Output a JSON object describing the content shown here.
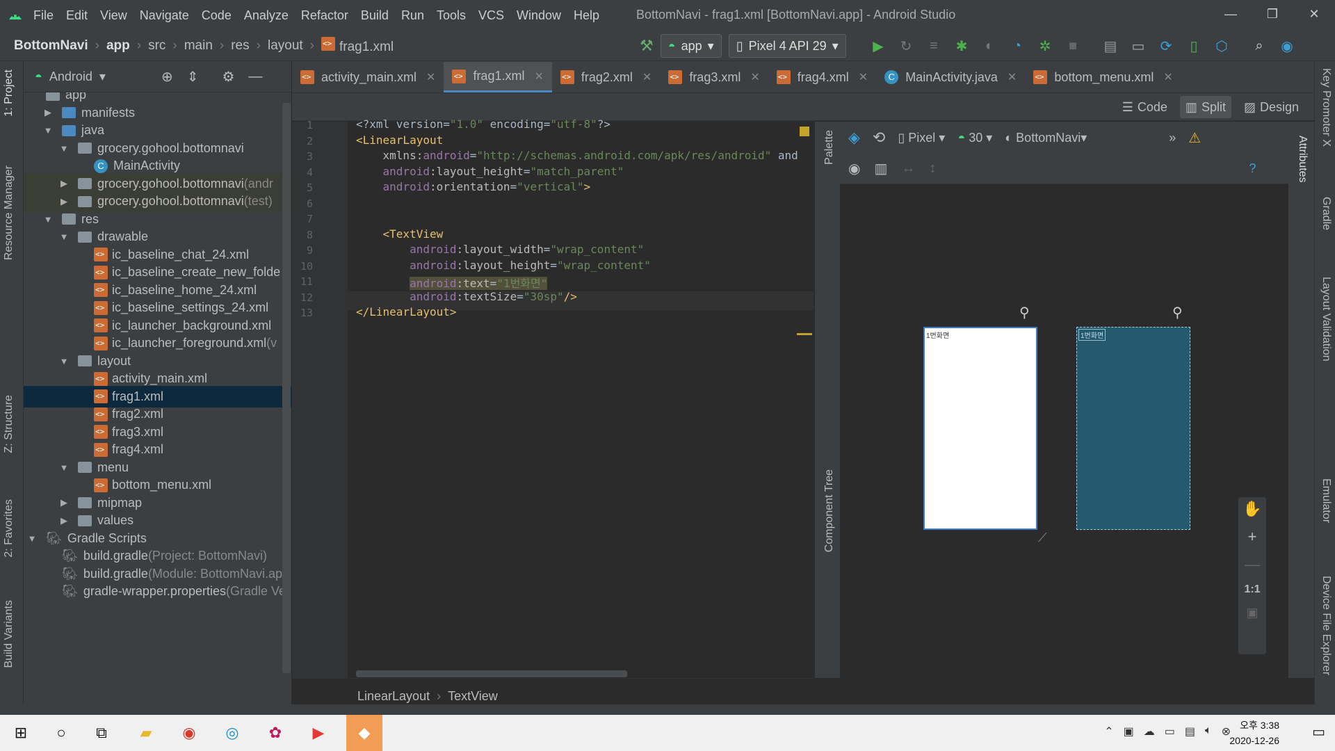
{
  "titlebar": {
    "menu": [
      "File",
      "Edit",
      "View",
      "Navigate",
      "Code",
      "Analyze",
      "Refactor",
      "Build",
      "Run",
      "Tools",
      "VCS",
      "Window",
      "Help"
    ],
    "window_title": "BottomNavi - frag1.xml [BottomNavi.app] - Android Studio"
  },
  "navbar": {
    "crumbs": [
      "BottomNavi",
      "app",
      "src",
      "main",
      "res",
      "layout",
      "frag1.xml"
    ],
    "run_config": "app",
    "device": "Pixel 4 API 29"
  },
  "left_strip": [
    "1: Project",
    "Resource Manager",
    "Z: Structure",
    "2: Favorites",
    "Build Variants"
  ],
  "right_strip": [
    "Key Promoter X",
    "Gradle",
    "Layout Validation",
    "Emulator",
    "Device File Explorer"
  ],
  "project": {
    "view": "Android",
    "tree": [
      {
        "label": "app",
        "indent": 0,
        "arrow": "",
        "icon": "folder"
      },
      {
        "label": "manifests",
        "indent": 1,
        "arrow": "▶",
        "icon": "folder-blue"
      },
      {
        "label": "java",
        "indent": 1,
        "arrow": "▼",
        "icon": "folder-blue"
      },
      {
        "label": "grocery.gohool.bottomnavi",
        "indent": 2,
        "arrow": "▼",
        "icon": "folder"
      },
      {
        "label": "MainActivity",
        "indent": 3,
        "arrow": "",
        "icon": "class"
      },
      {
        "label": "grocery.gohool.bottomnavi",
        "suffix": " (andr",
        "indent": 2,
        "arrow": "▶",
        "icon": "folder",
        "state": "hl"
      },
      {
        "label": "grocery.gohool.bottomnavi",
        "suffix": " (test)",
        "indent": 2,
        "arrow": "▶",
        "icon": "folder",
        "state": "hl"
      },
      {
        "label": "res",
        "indent": 1,
        "arrow": "▼",
        "icon": "folder"
      },
      {
        "label": "drawable",
        "indent": 2,
        "arrow": "▼",
        "icon": "folder"
      },
      {
        "label": "ic_baseline_chat_24.xml",
        "indent": 3,
        "arrow": "",
        "icon": "xml"
      },
      {
        "label": "ic_baseline_create_new_folde",
        "indent": 3,
        "arrow": "",
        "icon": "xml"
      },
      {
        "label": "ic_baseline_home_24.xml",
        "indent": 3,
        "arrow": "",
        "icon": "xml"
      },
      {
        "label": "ic_baseline_settings_24.xml",
        "indent": 3,
        "arrow": "",
        "icon": "xml"
      },
      {
        "label": "ic_launcher_background.xml",
        "indent": 3,
        "arrow": "",
        "icon": "xml"
      },
      {
        "label": "ic_launcher_foreground.xml",
        "suffix": " (v",
        "indent": 3,
        "arrow": "",
        "icon": "xml"
      },
      {
        "label": "layout",
        "indent": 2,
        "arrow": "▼",
        "icon": "folder"
      },
      {
        "label": "activity_main.xml",
        "indent": 3,
        "arrow": "",
        "icon": "xml"
      },
      {
        "label": "frag1.xml",
        "indent": 3,
        "arrow": "",
        "icon": "xml",
        "state": "sel"
      },
      {
        "label": "frag2.xml",
        "indent": 3,
        "arrow": "",
        "icon": "xml"
      },
      {
        "label": "frag3.xml",
        "indent": 3,
        "arrow": "",
        "icon": "xml"
      },
      {
        "label": "frag4.xml",
        "indent": 3,
        "arrow": "",
        "icon": "xml"
      },
      {
        "label": "menu",
        "indent": 2,
        "arrow": "▼",
        "icon": "folder"
      },
      {
        "label": "bottom_menu.xml",
        "indent": 3,
        "arrow": "",
        "icon": "xml"
      },
      {
        "label": "mipmap",
        "indent": 2,
        "arrow": "▶",
        "icon": "folder"
      },
      {
        "label": "values",
        "indent": 2,
        "arrow": "▶",
        "icon": "folder"
      },
      {
        "label": "Gradle Scripts",
        "indent": 0,
        "arrow": "▼",
        "icon": "gradle"
      },
      {
        "label": "build.gradle",
        "suffix": " (Project: BottomNavi)",
        "indent": 1,
        "arrow": "",
        "icon": "gradle"
      },
      {
        "label": "build.gradle",
        "suffix": " (Module: BottomNavi.ap",
        "indent": 1,
        "arrow": "",
        "icon": "gradle"
      },
      {
        "label": "gradle-wrapper.properties",
        "suffix": " (Gradle Ve",
        "indent": 1,
        "arrow": "",
        "icon": "props"
      }
    ]
  },
  "tabs": [
    {
      "label": "activity_main.xml",
      "icon": "xml"
    },
    {
      "label": "frag1.xml",
      "icon": "xml",
      "active": true
    },
    {
      "label": "frag2.xml",
      "icon": "xml"
    },
    {
      "label": "frag3.xml",
      "icon": "xml"
    },
    {
      "label": "frag4.xml",
      "icon": "xml"
    },
    {
      "label": "MainActivity.java",
      "icon": "class"
    },
    {
      "label": "bottom_menu.xml",
      "icon": "xml"
    }
  ],
  "modes": [
    "Code",
    "Split",
    "Design"
  ],
  "code": {
    "line_numbers": [
      "1",
      "2",
      "3",
      "4",
      "5",
      "6",
      "7",
      "8",
      "9",
      "10",
      "11",
      "12",
      "13"
    ],
    "lines": [
      [
        [
          "pl",
          "<?xml version="
        ],
        [
          "val",
          "\"1.0\""
        ],
        [
          "pl",
          " encoding="
        ],
        [
          "val",
          "\"utf-8\""
        ],
        [
          "pl",
          "?>"
        ]
      ],
      [
        [
          "tag",
          "<LinearLayout"
        ]
      ],
      [
        [
          "pl",
          "    "
        ],
        [
          "att",
          "xmlns:"
        ],
        [
          "ns",
          "android"
        ],
        [
          "pl",
          "="
        ],
        [
          "val",
          "\"http://schemas.android.com/apk/res/android\""
        ],
        [
          "pl",
          " and"
        ]
      ],
      [
        [
          "pl",
          "    "
        ],
        [
          "ns",
          "android"
        ],
        [
          "att",
          ":layout_height"
        ],
        [
          "pl",
          "="
        ],
        [
          "val",
          "\"match_parent\""
        ]
      ],
      [
        [
          "pl",
          "    "
        ],
        [
          "ns",
          "android"
        ],
        [
          "att",
          ":orientation"
        ],
        [
          "pl",
          "="
        ],
        [
          "val",
          "\"vertical\""
        ],
        [
          "tag",
          ">"
        ]
      ],
      [],
      [],
      [
        [
          "pl",
          "    "
        ],
        [
          "tag",
          "<TextView"
        ]
      ],
      [
        [
          "pl",
          "        "
        ],
        [
          "ns",
          "android"
        ],
        [
          "att",
          ":layout_width"
        ],
        [
          "pl",
          "="
        ],
        [
          "val",
          "\"wrap_content\""
        ]
      ],
      [
        [
          "pl",
          "        "
        ],
        [
          "ns",
          "android"
        ],
        [
          "att",
          ":layout_height"
        ],
        [
          "pl",
          "="
        ],
        [
          "val",
          "\"wrap_content\""
        ]
      ],
      [
        [
          "pl",
          "        "
        ],
        [
          "ns",
          "android"
        ],
        [
          "att",
          ":text"
        ],
        [
          "pl",
          "="
        ],
        [
          "val",
          "\"1번화면\""
        ]
      ],
      [
        [
          "pl",
          "        "
        ],
        [
          "ns",
          "android"
        ],
        [
          "att",
          ":textSize"
        ],
        [
          "pl",
          "="
        ],
        [
          "val",
          "\"30sp\""
        ],
        [
          "tag",
          "/>"
        ]
      ],
      [
        [
          "tag",
          "</LinearLayout>"
        ]
      ]
    ]
  },
  "editor_crumbs": [
    "LinearLayout",
    "TextView"
  ],
  "design": {
    "palette_label": "Palette",
    "component_tree_label": "Component Tree",
    "attributes_label": "Attributes",
    "device": "Pixel",
    "api": "30",
    "theme": "BottomNavi",
    "preview_text": "1번화면",
    "blueprint_text": "1번화면",
    "zoom_fit": "1:1"
  },
  "taskbar": {
    "time": "오후 3:38",
    "date": "2020-12-26"
  },
  "colors": {
    "accent": "#4a88c7",
    "selection": "#0d293e",
    "panel": "#3c3f41",
    "editor": "#2b2b2b",
    "blueprint": "#24596e"
  }
}
